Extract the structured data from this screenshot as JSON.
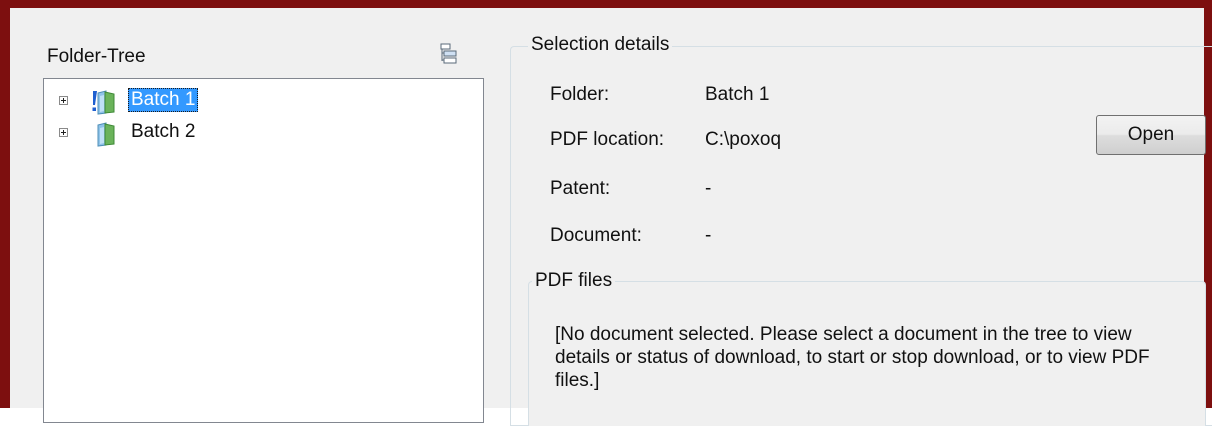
{
  "folder_tree": {
    "title": "Folder-Tree",
    "options_icon": "tree-options-icon",
    "nodes": [
      {
        "label": "Batch 1",
        "icon": "folder-warning-icon",
        "selected": true
      },
      {
        "label": "Batch 2",
        "icon": "folder-icon",
        "selected": false
      }
    ]
  },
  "selection_details": {
    "title": "Selection details",
    "fields": [
      {
        "label": "Folder:",
        "value": "Batch 1"
      },
      {
        "label": "PDF location:",
        "value": "C:\\poxoq"
      },
      {
        "label": "Patent:",
        "value": "-"
      },
      {
        "label": "Document:",
        "value": "-"
      }
    ],
    "open_button_label": "Open"
  },
  "pdf_files": {
    "title": "PDF files",
    "message": "[No document selected. Please select a document in the tree to view details or status of download, to start or stop download, or to view PDF files.]"
  },
  "colors": {
    "window_border": "#7d0f0f",
    "selection_highlight": "#3399ff",
    "folder_green": "#6ab35a",
    "folder_blue": "#8fc3e8",
    "warning_blue": "#1f5fd0"
  }
}
